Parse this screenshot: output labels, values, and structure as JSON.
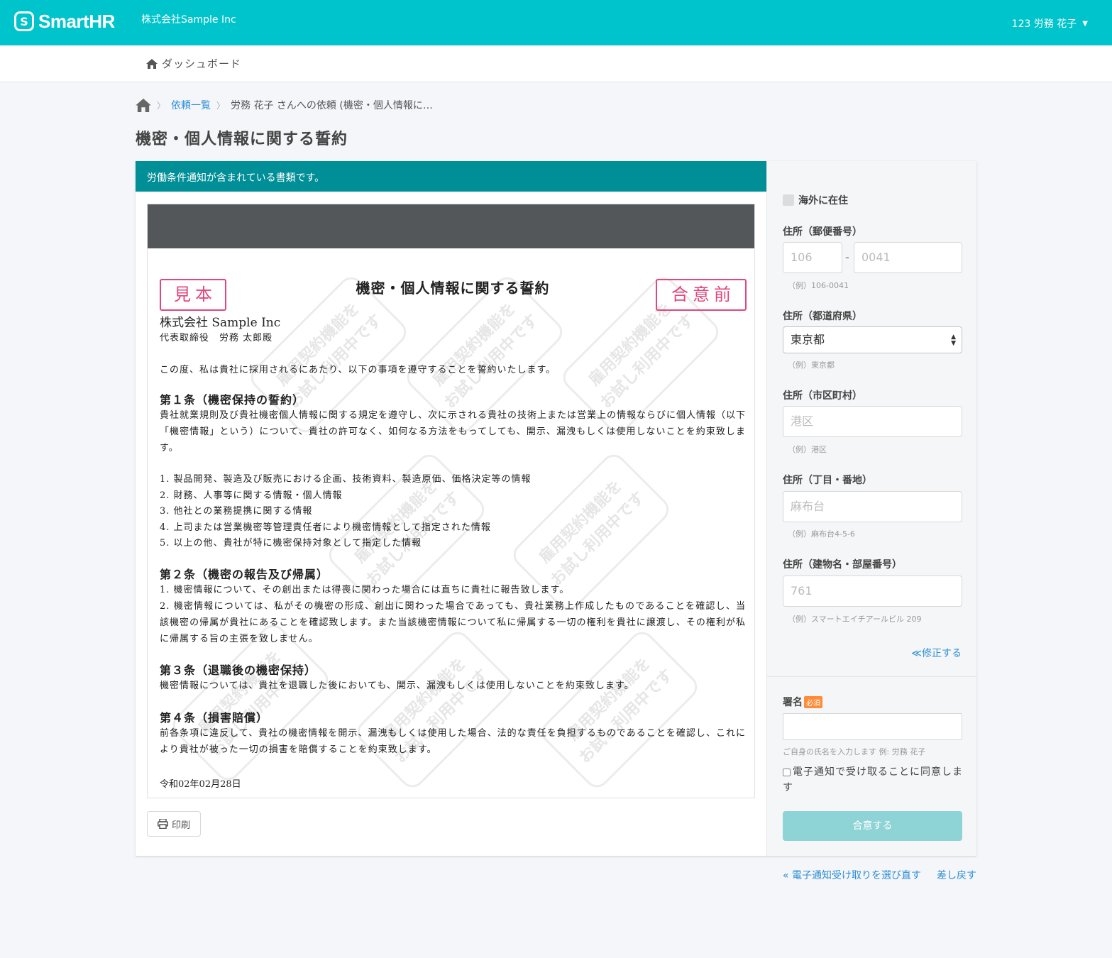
{
  "header": {
    "logo_mark": "S",
    "logo_text": "SmartHR",
    "company": "株式会社Sample Inc",
    "user": "123 労務 花子",
    "brand_color": "#00c4cc"
  },
  "subnav": {
    "dashboard": "ダッシュボード"
  },
  "breadcrumb": {
    "list": "依頼一覧",
    "current": "労務 花子 さんへの依頼 (機密・個人情報に…"
  },
  "page_title": "機密・個人情報に関する誓約",
  "notice": "労働条件通知が含まれている書類です。",
  "document": {
    "stamp_sample": "見本",
    "stamp_before": "合意前",
    "watermark_line1": "雇用契約機能を",
    "watermark_line2": "お試し利用中です",
    "title": "機密・個人情報に関する誓約",
    "company": "株式会社 Sample Inc",
    "representative": "代表取締役　労務 太郎殿",
    "intro": "この度、私は貴社に採用されるにあたり、以下の事項を遵守することを誓約いたします。",
    "art1_head": "第１条（機密保持の誓約）",
    "art1_body": "貴社就業規則及び貴社機密個人情報に関する規定を遵守し、次に示される貴社の技術上または営業上の情報ならびに個人情報（以下「機密情報」という）について、貴社の許可なく、如何なる方法をもってしても、開示、漏洩もしくは使用しないことを約束致します。",
    "art1_items": [
      "1. 製品開発、製造及び販売における企画、技術資料、製造原価、価格決定等の情報",
      "2. 財務、人事等に関する情報・個人情報",
      "3. 他社との業務提携に関する情報",
      "4. 上司または営業機密等管理責任者により機密情報として指定された情報",
      "5. 以上の他、貴社が特に機密保持対象として指定した情報"
    ],
    "art2_head": "第２条（機密の報告及び帰属）",
    "art2_p1": "1. 機密情報について、その創出または得喪に関わった場合には直ちに貴社に報告致します。",
    "art2_p2": "2. 機密情報については、私がその機密の形成、創出に関わった場合であっても、貴社業務上作成したものであることを確認し、当該機密の帰属が貴社にあることを確認致します。また当該機密情報について私に帰属する一切の権利を貴社に譲渡し、その権利が私に帰属する旨の主張を致しません。",
    "art3_head": "第３条（退職後の機密保持）",
    "art3_body": "機密情報については、貴社を退職した後においても、開示、漏洩もしくは使用しないことを約束致します。",
    "art4_head": "第４条（損害賠償）",
    "art4_body": "前各条項に違反して、貴社の機密情報を開示、漏洩もしくは使用した場合、法的な責任を負担するものであることを確認し、これにより貴社が被った一切の損害を賠償することを約束致します。",
    "date": "令和02年02月28日",
    "stamp_color": "#e2467b"
  },
  "print_button": "印刷",
  "form": {
    "overseas": "海外に在住",
    "zip_label": "住所（郵便番号）",
    "zip1_placeholder": "106",
    "zip_dash": "-",
    "zip2_placeholder": "0041",
    "zip_hint": "（例）106-0041",
    "pref_label": "住所（都道府県）",
    "pref_value": "東京都",
    "pref_hint": "（例）東京都",
    "city_label": "住所（市区町村）",
    "city_placeholder": "港区",
    "city_hint": "（例）港区",
    "street_label": "住所（丁目・番地）",
    "street_placeholder": "麻布台",
    "street_hint": "（例）麻布台4-5-6",
    "building_label": "住所（建物名・部屋番号）",
    "building_placeholder": "761",
    "building_hint": "（例）スマートエイチアールビル 209",
    "edit_link": "≪修正する",
    "signature_label": "署名",
    "required_badge": "必須",
    "signature_hint": "ご自身の氏名を入力します 例: 労務 花子",
    "agree_checkbox": "電子通知で受け取ることに同意します",
    "agree_button": "合意する"
  },
  "footer_links": {
    "reselect": "« 電子通知受け取りを選び直す",
    "return": "差し戻す"
  }
}
